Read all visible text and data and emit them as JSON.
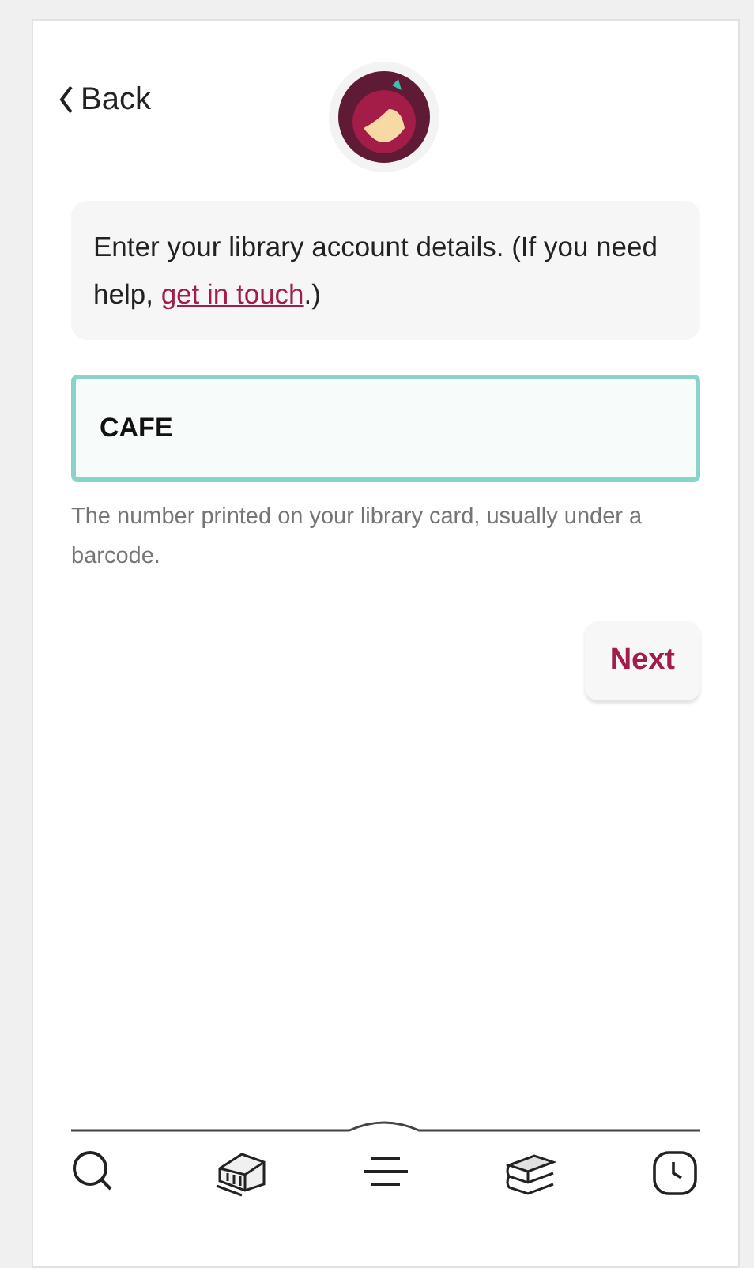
{
  "header": {
    "back_label": "Back"
  },
  "message": {
    "text_before": "Enter your library account details. (If you need help, ",
    "link": "get in touch",
    "text_after": ".)"
  },
  "card_field": {
    "value": "CAFE",
    "helper": "The number printed on your library card, usually under a barcode."
  },
  "next_button": "Next",
  "nav": [
    {
      "kind": "search"
    },
    {
      "kind": "library"
    },
    {
      "kind": "menu"
    },
    {
      "kind": "shelf"
    },
    {
      "kind": "clock"
    }
  ]
}
